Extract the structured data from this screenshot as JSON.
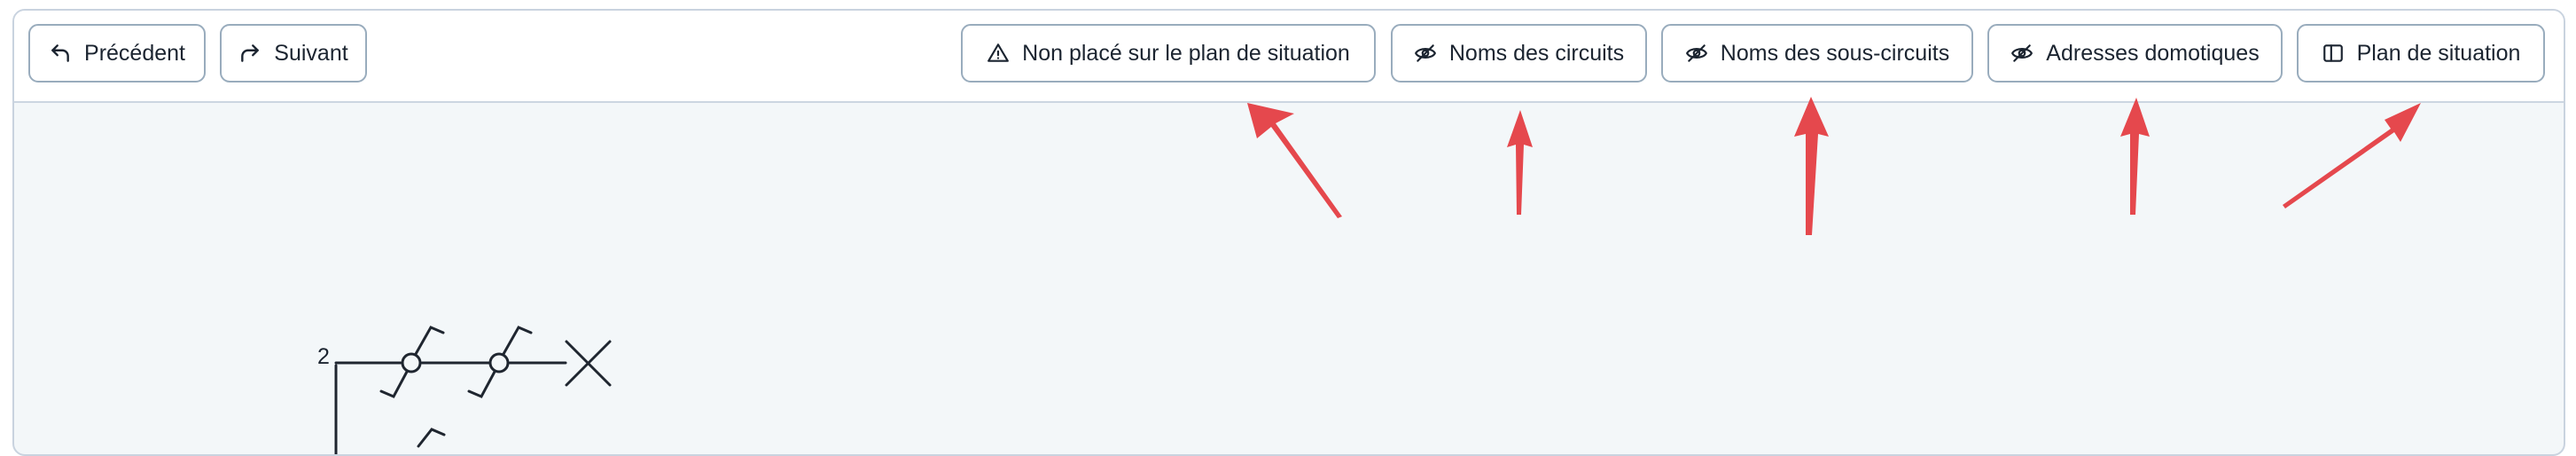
{
  "toolbar": {
    "previous_label": "Précédent",
    "next_label": "Suivant",
    "unplaced_label": "Non placé sur le plan de situation",
    "circuit_names_label": "Noms des circuits",
    "subcircuit_names_label": "Noms des sous-circuits",
    "home_automation_label": "Adresses domotiques",
    "site_plan_label": "Plan de situation"
  },
  "icons": {
    "previous": "undo-arrow-icon",
    "next": "redo-arrow-icon",
    "unplaced": "warning-triangle-icon",
    "circuit_names": "eye-off-icon",
    "subcircuit_names": "eye-off-icon",
    "home_automation": "eye-off-icon",
    "site_plan": "split-panel-icon"
  },
  "diagram": {
    "circuit_number": "2"
  },
  "colors": {
    "annotation_arrow": "#e5484d",
    "canvas_background": "#f3f7f9",
    "button_border": "#99acbd"
  }
}
